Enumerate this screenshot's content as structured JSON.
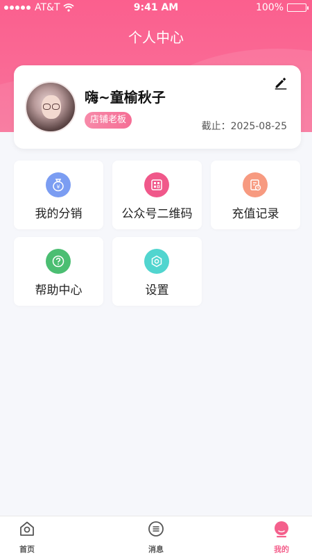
{
  "status_bar": {
    "carrier": "AT&T",
    "time": "9:41 AM",
    "battery": "100%"
  },
  "header": {
    "title": "个人中心"
  },
  "profile": {
    "name": "嗨~童榆秋子",
    "role": "店铺老板",
    "expiry": "截止：2025-08-25"
  },
  "menu": [
    {
      "label": "我的分销",
      "icon": "money-bag-icon",
      "color": "#7b9df2"
    },
    {
      "label": "公众号二维码",
      "icon": "qrcode-icon",
      "color": "#f0588a"
    },
    {
      "label": "充值记录",
      "icon": "record-icon",
      "color": "#f79a80"
    },
    {
      "label": "帮助中心",
      "icon": "help-icon",
      "color": "#4bbe72"
    },
    {
      "label": "设置",
      "icon": "settings-icon",
      "color": "#51d5cf"
    }
  ],
  "tabs": [
    {
      "label": "首页",
      "icon": "home-icon"
    },
    {
      "label": "消息",
      "icon": "message-icon"
    },
    {
      "label": "我的",
      "icon": "profile-icon",
      "active": true
    }
  ],
  "colors": {
    "accent": "#f4608c",
    "background": "#f6f7fb"
  }
}
